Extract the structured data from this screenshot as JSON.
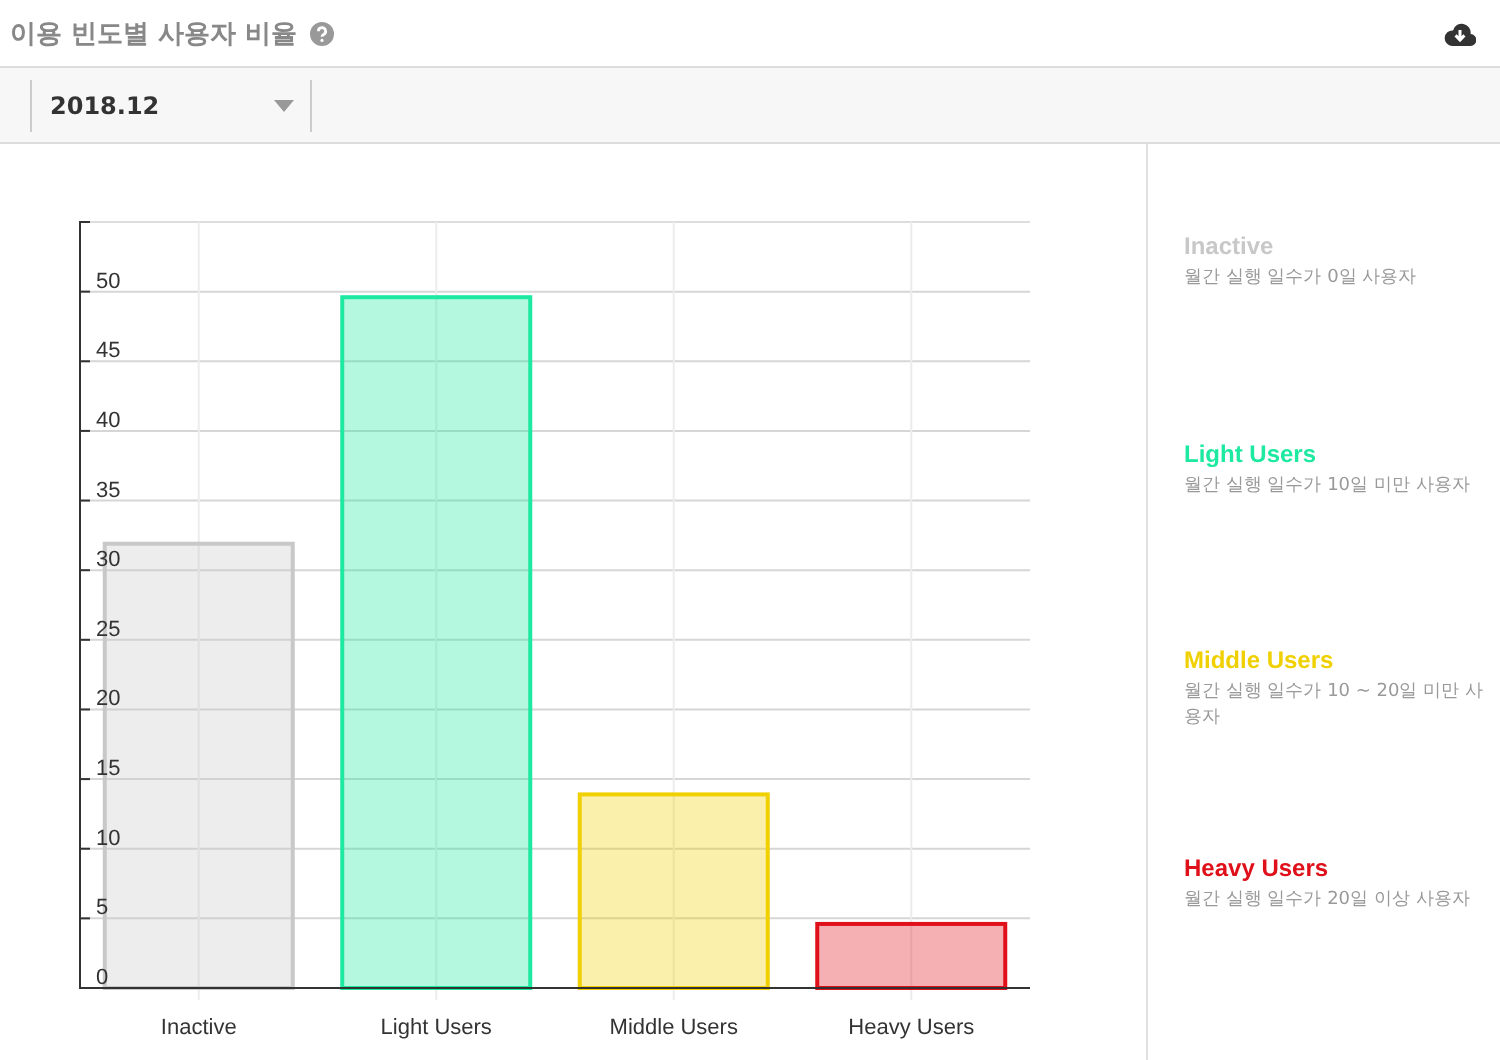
{
  "header": {
    "title": "이용 빈도별 사용자 비율"
  },
  "toolbar": {
    "period": "2018.12"
  },
  "chart": {
    "chart_data": {
      "type": "bar",
      "stacked": true,
      "grid": true,
      "categories": [
        "Inactive",
        "Light Users",
        "Middle Users",
        "Heavy Users"
      ],
      "series": [
        {
          "name": "Inactive",
          "color": "#c8c8c8",
          "values": [
            31.9,
            null,
            null,
            null
          ]
        },
        {
          "name": "Light Users",
          "color": "#1de9a0",
          "values": [
            null,
            49.6,
            null,
            null
          ]
        },
        {
          "name": "Middle Users",
          "color": "#f0d000",
          "values": [
            null,
            null,
            13.9,
            null
          ]
        },
        {
          "name": "Heavy Users",
          "color": "#e0101a",
          "values": [
            null,
            null,
            null,
            4.6
          ]
        }
      ],
      "ylim": [
        0,
        55
      ],
      "yticks": [
        0,
        5,
        10,
        15,
        20,
        25,
        30,
        35,
        40,
        45,
        50
      ]
    }
  },
  "legend": [
    {
      "description": "월간 실행 일수가 0일 사용자"
    },
    {
      "description": "월간 실행 일수가 10일 미만 사용자"
    },
    {
      "description": "월간 실행 일수가 10 ~ 20일 미만 사용자"
    },
    {
      "description": "월간 실행 일수가 20일 이상 사용자"
    }
  ]
}
